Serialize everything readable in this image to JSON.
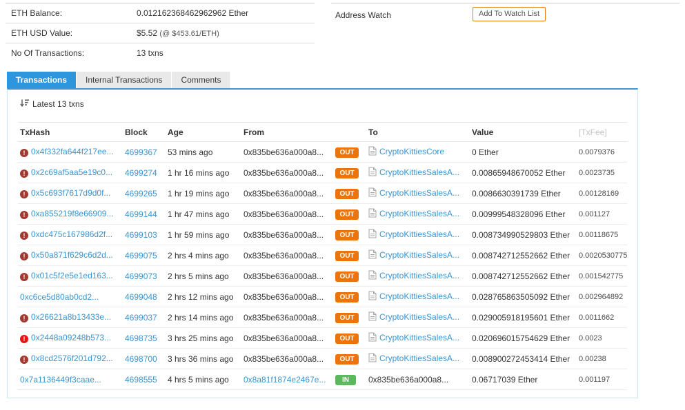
{
  "info": {
    "eth_balance_label": "ETH Balance:",
    "eth_balance_value": "0.012162368462962962 Ether",
    "eth_usd_label": "ETH USD Value:",
    "eth_usd_value": "$5.52",
    "eth_usd_rate": "(@ $453.61/ETH)",
    "tx_count_label": "No Of Transactions:",
    "tx_count_value": "13 txns"
  },
  "watch": {
    "label": "Address Watch",
    "button_label": "Add To Watch List"
  },
  "tabs": [
    {
      "label": "Transactions",
      "active": true
    },
    {
      "label": "Internal Transactions",
      "active": false
    },
    {
      "label": "Comments",
      "active": false
    }
  ],
  "panel": {
    "latest_label": "Latest 13 txns"
  },
  "table": {
    "headers": {
      "txhash": "TxHash",
      "block": "Block",
      "age": "Age",
      "from": "From",
      "to": "To",
      "value": "Value",
      "txfee": "[TxFee]"
    },
    "rows": [
      {
        "err": "dark",
        "hash": "0x4f332fa644f217ee...",
        "block": "4699367",
        "age": "53 mins ago",
        "from": "0x835be636a000a8...",
        "from_is_link": false,
        "dir": "OUT",
        "to": "CryptoKittiesCore",
        "to_is_link": true,
        "to_is_contract": true,
        "value": "0 Ether",
        "fee": "0.0079376"
      },
      {
        "err": "dark",
        "hash": "0x2c69af5aa5e19c0...",
        "block": "4699274",
        "age": "1 hr 16 mins ago",
        "from": "0x835be636a000a8...",
        "from_is_link": false,
        "dir": "OUT",
        "to": "CryptoKittiesSalesA...",
        "to_is_link": true,
        "to_is_contract": true,
        "value": "0.00865948670052 Ether",
        "fee": "0.0023735"
      },
      {
        "err": "dark",
        "hash": "0x5c693f7617d9d0f...",
        "block": "4699265",
        "age": "1 hr 19 mins ago",
        "from": "0x835be636a000a8...",
        "from_is_link": false,
        "dir": "OUT",
        "to": "CryptoKittiesSalesA...",
        "to_is_link": true,
        "to_is_contract": true,
        "value": "0.0086630391739 Ether",
        "fee": "0.00128169"
      },
      {
        "err": "dark",
        "hash": "0xa855219f8e66909...",
        "block": "4699144",
        "age": "1 hr 47 mins ago",
        "from": "0x835be636a000a8...",
        "from_is_link": false,
        "dir": "OUT",
        "to": "CryptoKittiesSalesA...",
        "to_is_link": true,
        "to_is_contract": true,
        "value": "0.00999548328096 Ether",
        "fee": "0.001127"
      },
      {
        "err": "dark",
        "hash": "0xdc475c167986d2f...",
        "block": "4699103",
        "age": "1 hr 59 mins ago",
        "from": "0x835be636a000a8...",
        "from_is_link": false,
        "dir": "OUT",
        "to": "CryptoKittiesSalesA...",
        "to_is_link": true,
        "to_is_contract": true,
        "value": "0.008734990529803 Ether",
        "fee": "0.00118675"
      },
      {
        "err": "dark",
        "hash": "0x50a871f629c6d2d...",
        "block": "4699075",
        "age": "2 hrs 4 mins ago",
        "from": "0x835be636a000a8...",
        "from_is_link": false,
        "dir": "OUT",
        "to": "CryptoKittiesSalesA...",
        "to_is_link": true,
        "to_is_contract": true,
        "value": "0.008742712552662 Ether",
        "fee": "0.0020530775"
      },
      {
        "err": "dark",
        "hash": "0x01c5f2e5e1ed163...",
        "block": "4699073",
        "age": "2 hrs 5 mins ago",
        "from": "0x835be636a000a8...",
        "from_is_link": false,
        "dir": "OUT",
        "to": "CryptoKittiesSalesA...",
        "to_is_link": true,
        "to_is_contract": true,
        "value": "0.008742712552662 Ether",
        "fee": "0.001542775"
      },
      {
        "err": null,
        "hash": "0xc6ce5d80ab0cd2...",
        "block": "4699048",
        "age": "2 hrs 12 mins ago",
        "from": "0x835be636a000a8...",
        "from_is_link": false,
        "dir": "OUT",
        "to": "CryptoKittiesSalesA...",
        "to_is_link": true,
        "to_is_contract": true,
        "value": "0.028765863505092 Ether",
        "fee": "0.002964892"
      },
      {
        "err": "dark",
        "hash": "0x26621a8b13433e...",
        "block": "4699037",
        "age": "2 hrs 14 mins ago",
        "from": "0x835be636a000a8...",
        "from_is_link": false,
        "dir": "OUT",
        "to": "CryptoKittiesSalesA...",
        "to_is_link": true,
        "to_is_contract": true,
        "value": "0.029005918195601 Ether",
        "fee": "0.0011662"
      },
      {
        "err": "red",
        "hash": "0x2448a09248b573...",
        "block": "4698735",
        "age": "3 hrs 25 mins ago",
        "from": "0x835be636a000a8...",
        "from_is_link": false,
        "dir": "OUT",
        "to": "CryptoKittiesSalesA...",
        "to_is_link": true,
        "to_is_contract": true,
        "value": "0.020696015754629 Ether",
        "fee": "0.0023"
      },
      {
        "err": "dark",
        "hash": "0x8cd2576f201d792...",
        "block": "4698700",
        "age": "3 hrs 36 mins ago",
        "from": "0x835be636a000a8...",
        "from_is_link": false,
        "dir": "OUT",
        "to": "CryptoKittiesSalesA...",
        "to_is_link": true,
        "to_is_contract": true,
        "value": "0.008900272453414 Ether",
        "fee": "0.00238"
      },
      {
        "err": null,
        "hash": "0x7a1136449f3caae...",
        "block": "4698555",
        "age": "4 hrs 5 mins ago",
        "from": "0x8a81f1874e2467e...",
        "from_is_link": true,
        "dir": "IN",
        "to": "0x835be636a000a8...",
        "to_is_link": false,
        "to_is_contract": false,
        "value": "0.06717039 Ether",
        "fee": "0.001197"
      }
    ]
  },
  "colors": {
    "accent_blue": "#2e96dd",
    "panel_border": "#c9e8f5",
    "link": "#3a95d2",
    "out_badge": "#ec740c",
    "in_badge": "#5cb85c",
    "error_dark": "#a23931",
    "error_red": "#e91313",
    "watch_button_border": "#e0820e"
  }
}
